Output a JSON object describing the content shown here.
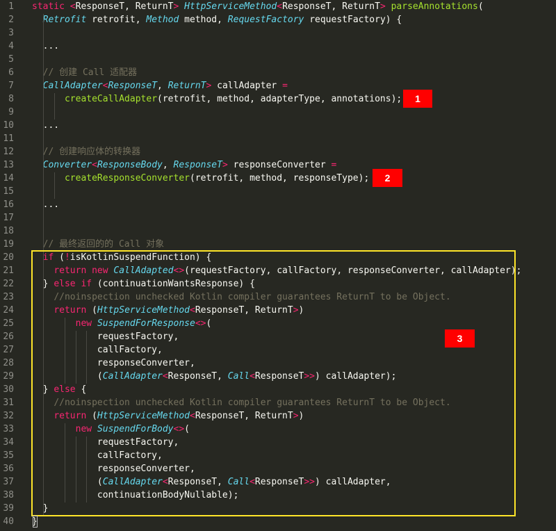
{
  "colors": {
    "background": "#272822",
    "line_number": "#90908a",
    "default": "#f8f8f2",
    "keyword": "#f92672",
    "type": "#66d9ef",
    "function": "#a6e22e",
    "comment": "#75715e",
    "badge": "#ff0000",
    "highlight_box": "#ffe629"
  },
  "code_lines": [
    [
      [
        "kw",
        "static "
      ],
      [
        "op",
        "<"
      ],
      [
        "p",
        "ResponseT, ReturnT"
      ],
      [
        "op",
        "> "
      ],
      [
        "ty",
        "HttpServiceMethod"
      ],
      [
        "op",
        "<"
      ],
      [
        "p",
        "ResponseT, ReturnT"
      ],
      [
        "op",
        "> "
      ],
      [
        "fn",
        "parseAnnotations"
      ],
      [
        "p",
        "("
      ]
    ],
    [
      [
        "p",
        "  "
      ],
      [
        "ty",
        "Retrofit"
      ],
      [
        "p",
        " retrofit, "
      ],
      [
        "ty",
        "Method"
      ],
      [
        "p",
        " method, "
      ],
      [
        "ty",
        "RequestFactory"
      ],
      [
        "p",
        " requestFactory) {"
      ]
    ],
    [],
    [
      [
        "p",
        "  ..."
      ]
    ],
    [],
    [
      [
        "p",
        "  "
      ],
      [
        "cm",
        "// 创建 Call 适配器"
      ]
    ],
    [
      [
        "p",
        "  "
      ],
      [
        "ty",
        "CallAdapter"
      ],
      [
        "op",
        "<"
      ],
      [
        "ty",
        "ResponseT"
      ],
      [
        "p",
        ", "
      ],
      [
        "ty",
        "ReturnT"
      ],
      [
        "op",
        ">"
      ],
      [
        "p",
        " callAdapter "
      ],
      [
        "op",
        "="
      ]
    ],
    [
      [
        "p",
        "      "
      ],
      [
        "fn",
        "createCallAdapter"
      ],
      [
        "p",
        "(retrofit, method, adapterType, annotations);"
      ]
    ],
    [],
    [
      [
        "p",
        "  ..."
      ]
    ],
    [],
    [
      [
        "p",
        "  "
      ],
      [
        "cm",
        "// 创建响应体的转换器"
      ]
    ],
    [
      [
        "p",
        "  "
      ],
      [
        "ty",
        "Converter"
      ],
      [
        "op",
        "<"
      ],
      [
        "ty",
        "ResponseBody"
      ],
      [
        "p",
        ", "
      ],
      [
        "ty",
        "ResponseT"
      ],
      [
        "op",
        ">"
      ],
      [
        "p",
        " responseConverter "
      ],
      [
        "op",
        "="
      ]
    ],
    [
      [
        "p",
        "      "
      ],
      [
        "fn",
        "createResponseConverter"
      ],
      [
        "p",
        "(retrofit, method, responseType);"
      ]
    ],
    [],
    [
      [
        "p",
        "  ..."
      ]
    ],
    [],
    [],
    [
      [
        "p",
        "  "
      ],
      [
        "cm",
        "// 最终返回的的 Call 对象"
      ]
    ],
    [
      [
        "p",
        "  "
      ],
      [
        "kw",
        "if"
      ],
      [
        "p",
        " ("
      ],
      [
        "op",
        "!"
      ],
      [
        "p",
        "isKotlinSuspendFunction) {"
      ]
    ],
    [
      [
        "p",
        "    "
      ],
      [
        "kw",
        "return new"
      ],
      [
        "p",
        " "
      ],
      [
        "ty",
        "CallAdapted"
      ],
      [
        "op",
        "<>"
      ],
      [
        "p",
        "(requestFactory, callFactory, responseConverter, callAdapter);"
      ]
    ],
    [
      [
        "p",
        "  } "
      ],
      [
        "kw",
        "else if"
      ],
      [
        "p",
        " (continuationWantsResponse) {"
      ]
    ],
    [
      [
        "p",
        "    "
      ],
      [
        "cm",
        "//noinspection unchecked Kotlin compiler guarantees ReturnT to be Object."
      ]
    ],
    [
      [
        "p",
        "    "
      ],
      [
        "kw",
        "return"
      ],
      [
        "p",
        " ("
      ],
      [
        "ty",
        "HttpServiceMethod"
      ],
      [
        "op",
        "<"
      ],
      [
        "p",
        "ResponseT, ReturnT"
      ],
      [
        "op",
        ">"
      ],
      [
        "p",
        ")"
      ]
    ],
    [
      [
        "p",
        "        "
      ],
      [
        "kw",
        "new"
      ],
      [
        "p",
        " "
      ],
      [
        "ty",
        "SuspendForResponse"
      ],
      [
        "op",
        "<>"
      ],
      [
        "p",
        "("
      ]
    ],
    [
      [
        "p",
        "            requestFactory,"
      ]
    ],
    [
      [
        "p",
        "            callFactory,"
      ]
    ],
    [
      [
        "p",
        "            responseConverter,"
      ]
    ],
    [
      [
        "p",
        "            ("
      ],
      [
        "ty",
        "CallAdapter"
      ],
      [
        "op",
        "<"
      ],
      [
        "p",
        "ResponseT, "
      ],
      [
        "ty",
        "Call"
      ],
      [
        "op",
        "<"
      ],
      [
        "p",
        "ResponseT"
      ],
      [
        "op",
        ">>"
      ],
      [
        "p",
        ") callAdapter);"
      ]
    ],
    [
      [
        "p",
        "  } "
      ],
      [
        "kw",
        "else"
      ],
      [
        "p",
        " {"
      ]
    ],
    [
      [
        "p",
        "    "
      ],
      [
        "cm",
        "//noinspection unchecked Kotlin compiler guarantees ReturnT to be Object."
      ]
    ],
    [
      [
        "p",
        "    "
      ],
      [
        "kw",
        "return"
      ],
      [
        "p",
        " ("
      ],
      [
        "ty",
        "HttpServiceMethod"
      ],
      [
        "op",
        "<"
      ],
      [
        "p",
        "ResponseT, ReturnT"
      ],
      [
        "op",
        ">"
      ],
      [
        "p",
        ")"
      ]
    ],
    [
      [
        "p",
        "        "
      ],
      [
        "kw",
        "new"
      ],
      [
        "p",
        " "
      ],
      [
        "ty",
        "SuspendForBody"
      ],
      [
        "op",
        "<>"
      ],
      [
        "p",
        "("
      ]
    ],
    [
      [
        "p",
        "            requestFactory,"
      ]
    ],
    [
      [
        "p",
        "            callFactory,"
      ]
    ],
    [
      [
        "p",
        "            responseConverter,"
      ]
    ],
    [
      [
        "p",
        "            ("
      ],
      [
        "ty",
        "CallAdapter"
      ],
      [
        "op",
        "<"
      ],
      [
        "p",
        "ResponseT, "
      ],
      [
        "ty",
        "Call"
      ],
      [
        "op",
        "<"
      ],
      [
        "p",
        "ResponseT"
      ],
      [
        "op",
        ">>"
      ],
      [
        "p",
        ") callAdapter,"
      ]
    ],
    [
      [
        "p",
        "            continuationBodyNullable);"
      ]
    ],
    [
      [
        "p",
        "  }"
      ]
    ],
    [
      [
        "p",
        "}"
      ]
    ]
  ],
  "badges": [
    "1",
    "2",
    "3"
  ]
}
